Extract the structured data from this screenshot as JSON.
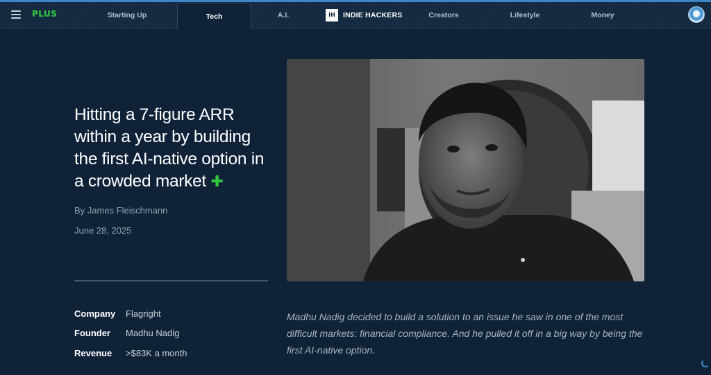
{
  "nav": {
    "plus_label": "PLUS",
    "items": [
      {
        "label": "Starting Up"
      },
      {
        "label": "Tech"
      },
      {
        "label": "A.I."
      },
      {
        "label": "Creators"
      },
      {
        "label": "Lifestyle"
      },
      {
        "label": "Money"
      }
    ],
    "active": "Tech",
    "logo_mark": "IH",
    "logo_text": "INDIE HACKERS"
  },
  "article": {
    "title": "Hitting a 7-figure ARR within a year by building the first AI-native option in a crowded market",
    "title_badge": "✚",
    "byline": "By James Fleischmann",
    "date": "June 28, 2025",
    "excerpt": "Madhu Nadig decided to build a solution to an issue he saw in one of the most difficult markets: financial compliance. And he pulled it off in a big way by being the first AI-native option.",
    "meta": [
      {
        "label": "Company",
        "value": "Flagright"
      },
      {
        "label": "Founder",
        "value": "Madhu Nadig"
      },
      {
        "label": "Revenue",
        "value": ">$83K a month"
      }
    ]
  },
  "colors": {
    "background": "#0f2238",
    "accent_green": "#32c840",
    "accent_blue": "#3d86c8"
  },
  "icons": [
    "menu-icon",
    "user-avatar-icon",
    "loading-spinner-icon"
  ]
}
